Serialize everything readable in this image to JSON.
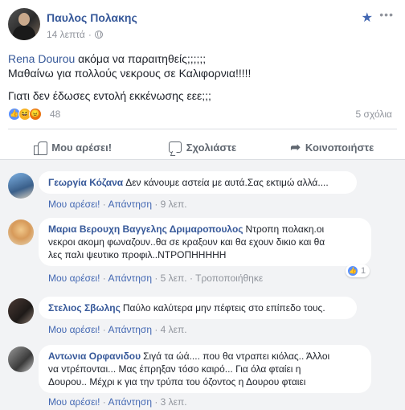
{
  "post": {
    "author": "Παυλος Πολακης",
    "time": "14 λεπτά",
    "mention": "Rena Dourou",
    "line1_rest": " ακόμα να παραιτηθείς;;;;;;",
    "line2": "Μαθαίνω για πολλούς νεκρους σε Καλιφορνια!!!!!",
    "line3": "Γιατι δεν έδωσες εντολή εκκένωσης εεε;;;"
  },
  "reactions": {
    "icons": [
      "like-icon",
      "haha-icon",
      "angry-icon"
    ],
    "count": "48",
    "comments": "5 σχόλια"
  },
  "actions": {
    "like": "Μου αρέσει!",
    "comment": "Σχολιάστε",
    "share": "Κοινοποιήστε"
  },
  "comments": [
    {
      "author": "Γεωργία Κόζανα",
      "text": "Δεν κάνουμε αστεία με αυτά.Σας εκτιμώ αλλά....",
      "like": "Μου αρέσει!",
      "reply": "Απάντηση",
      "time": "9 λεπ."
    },
    {
      "author": "Μαρια Βερουχη Βαγγελης Δριμαροπουλος",
      "text1": "Ντροπη πολακη.οι",
      "text2": "νεκροι ακομη φωναζουν..θα σε κραξουν και θα εχουν δικιο και θα",
      "text3": "λες παλι ψευτικο προφιλ..ΝΤΡΟΠΗΗΗΗΗ",
      "like": "Μου αρέσει!",
      "reply": "Απάντηση",
      "time": "5 λεπ.",
      "edited": "Τροποποιήθηκε",
      "reaction_count": "1"
    },
    {
      "author": "Στελιος Σβωλης",
      "text": "Παύλο καλύτερα μην πέφτεις στο επίπεδο τους.",
      "like": "Μου αρέσει!",
      "reply": "Απάντηση",
      "time": "4 λεπ."
    },
    {
      "author": "Αντωνια Ορφανιδου",
      "text1": "Σιγά τα ώά.... που θα ντραπει κιόλας.. Άλλοι",
      "text2": "να ντρέπονται... Μας έπρηξαν τόσο καιρό... Για όλα φταίει η",
      "text3": "Δουρου.. Μέχρι κ για την τρύπα του όζοντος η Δουρου φταιει",
      "like": "Μου αρέσει!",
      "reply": "Απάντηση",
      "time": "3 λεπ."
    }
  ],
  "colors": {
    "link": "#365899",
    "meta": "#90949c",
    "bg": "#f2f3f5"
  }
}
